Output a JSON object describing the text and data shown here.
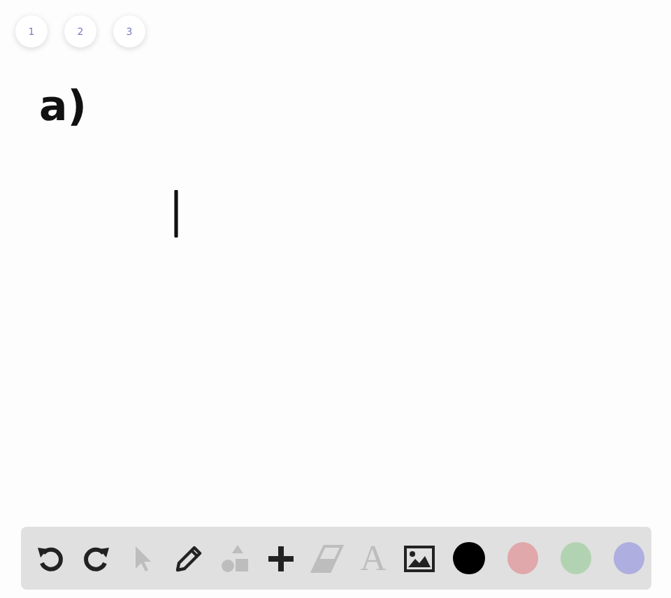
{
  "pages": [
    {
      "label": "1"
    },
    {
      "label": "2"
    },
    {
      "label": "3"
    }
  ],
  "canvas": {
    "ink_text": "a)"
  },
  "toolbar": {
    "tools": [
      {
        "kind": "undo",
        "disabled": false
      },
      {
        "kind": "redo",
        "disabled": false
      },
      {
        "kind": "select",
        "disabled": true
      },
      {
        "kind": "pencil",
        "disabled": false
      },
      {
        "kind": "shapes",
        "disabled": true
      },
      {
        "kind": "add",
        "disabled": false
      },
      {
        "kind": "eraser",
        "disabled": true
      },
      {
        "kind": "text",
        "label": "A",
        "disabled": true
      },
      {
        "kind": "image",
        "disabled": false
      }
    ],
    "colors": [
      {
        "color": "#000000"
      },
      {
        "color": "#e0a8ab"
      },
      {
        "color": "#b2d3b1"
      },
      {
        "color": "#afaee0"
      }
    ]
  }
}
